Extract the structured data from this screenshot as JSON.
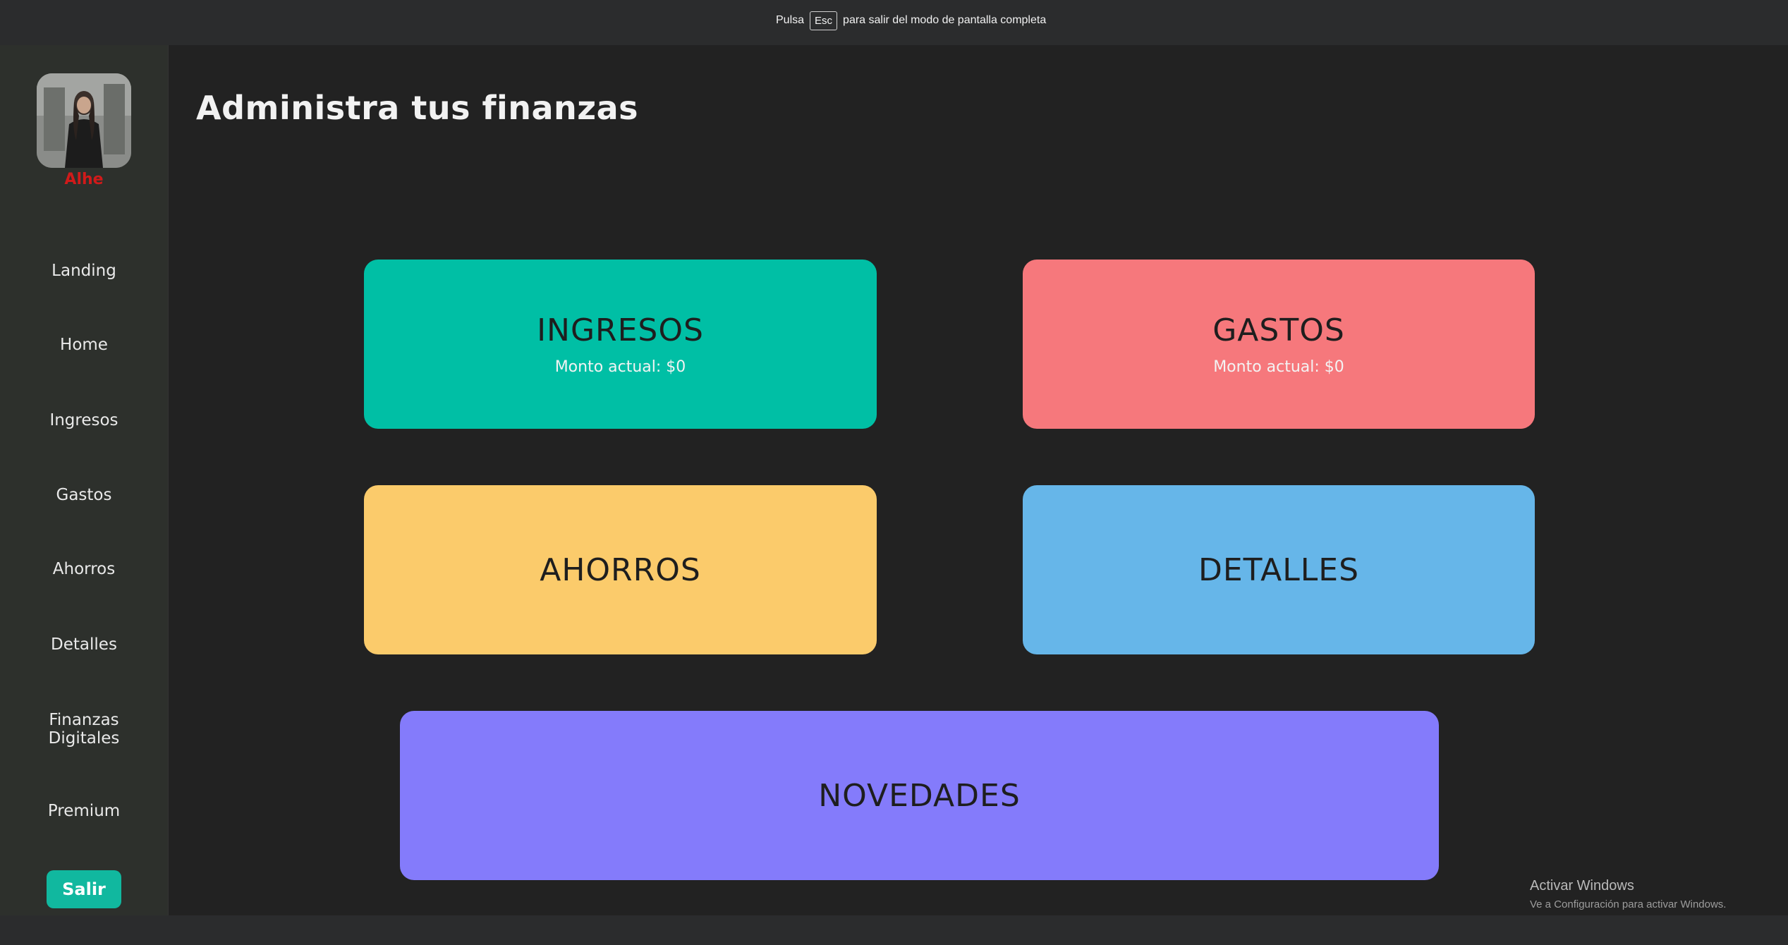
{
  "fullscreen_notice": {
    "prefix": "Pulsa",
    "key": "Esc",
    "suffix": "para salir del modo de pantalla completa"
  },
  "sidebar": {
    "user_name": "Alhe",
    "items": [
      {
        "label": "Landing"
      },
      {
        "label": "Home"
      },
      {
        "label": "Ingresos"
      },
      {
        "label": "Gastos"
      },
      {
        "label": "Ahorros"
      },
      {
        "label": "Detalles"
      },
      {
        "label": "Finanzas Digitales"
      },
      {
        "label": "Premium"
      }
    ],
    "logout_label": "Salir"
  },
  "main": {
    "title": "Administra tus finanzas",
    "cards": {
      "ingresos": {
        "title": "INGRESOS",
        "subtitle": "Monto actual: $0",
        "color": "#00bfa5"
      },
      "gastos": {
        "title": "GASTOS",
        "subtitle": "Monto actual: $0",
        "color": "#f6787c"
      },
      "ahorros": {
        "title": "AHORROS",
        "color": "#fbcb6b"
      },
      "detalles": {
        "title": "DETALLES",
        "color": "#66b6e9"
      },
      "novedades": {
        "title": "NOVEDADES",
        "color": "#847bfb"
      }
    }
  },
  "windows_watermark": {
    "title": "Activar Windows",
    "subtitle": "Ve a Configuración para activar Windows."
  }
}
